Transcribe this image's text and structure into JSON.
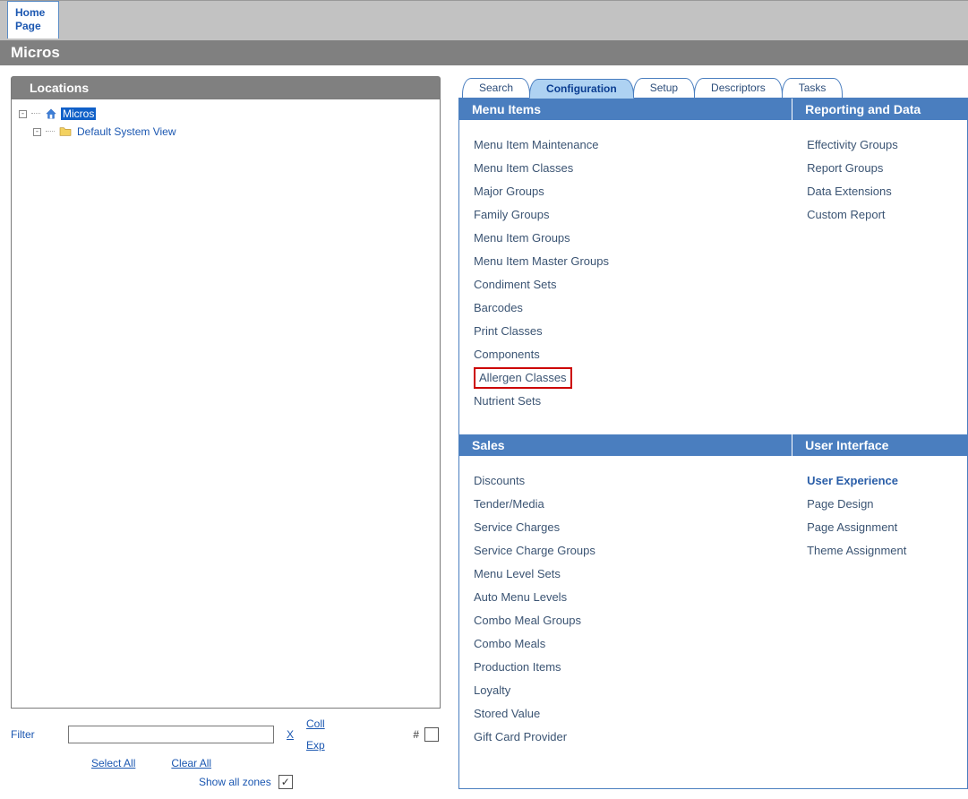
{
  "tabStrip": {
    "home": "Home\nPage"
  },
  "titleBar": "Micros",
  "sidebar": {
    "header": "Locations",
    "tree": {
      "rootLabel": "Micros",
      "childLabel": "Default System View"
    },
    "filter": {
      "label": "Filter",
      "clearX": "X",
      "coll": "Coll",
      "exp": "Exp",
      "hashLabel": "#",
      "selectAll": "Select All",
      "clearAll": "Clear All",
      "showAllZones": "Show all zones"
    }
  },
  "navTabs": [
    "Search",
    "Configuration",
    "Setup",
    "Descriptors",
    "Tasks"
  ],
  "activeTab": "Configuration",
  "sections": {
    "menuItems": {
      "header": "Menu Items",
      "items": [
        "Menu Item Maintenance",
        "Menu Item Classes",
        "Major Groups",
        "Family Groups",
        "Menu Item Groups",
        "Menu Item Master Groups",
        "Condiment Sets",
        "Barcodes",
        "Print Classes",
        "Components",
        "Allergen Classes",
        "Nutrient Sets"
      ],
      "highlight": "Allergen Classes"
    },
    "reporting": {
      "header": "Reporting and Data",
      "items": [
        "Effectivity Groups",
        "Report Groups",
        "Data Extensions",
        "Custom Report"
      ]
    },
    "sales": {
      "header": "Sales",
      "items": [
        "Discounts",
        "Tender/Media",
        "Service Charges",
        "Service Charge Groups",
        "Menu Level Sets",
        "Auto Menu Levels",
        "Combo Meal Groups",
        "Combo Meals",
        "Production Items",
        "Loyalty",
        "Stored Value",
        "Gift Card Provider"
      ]
    },
    "ui": {
      "header": "User Interface",
      "boldItem": "User Experience",
      "items": [
        "Page Design",
        "Page Assignment",
        "Theme Assignment"
      ]
    }
  }
}
